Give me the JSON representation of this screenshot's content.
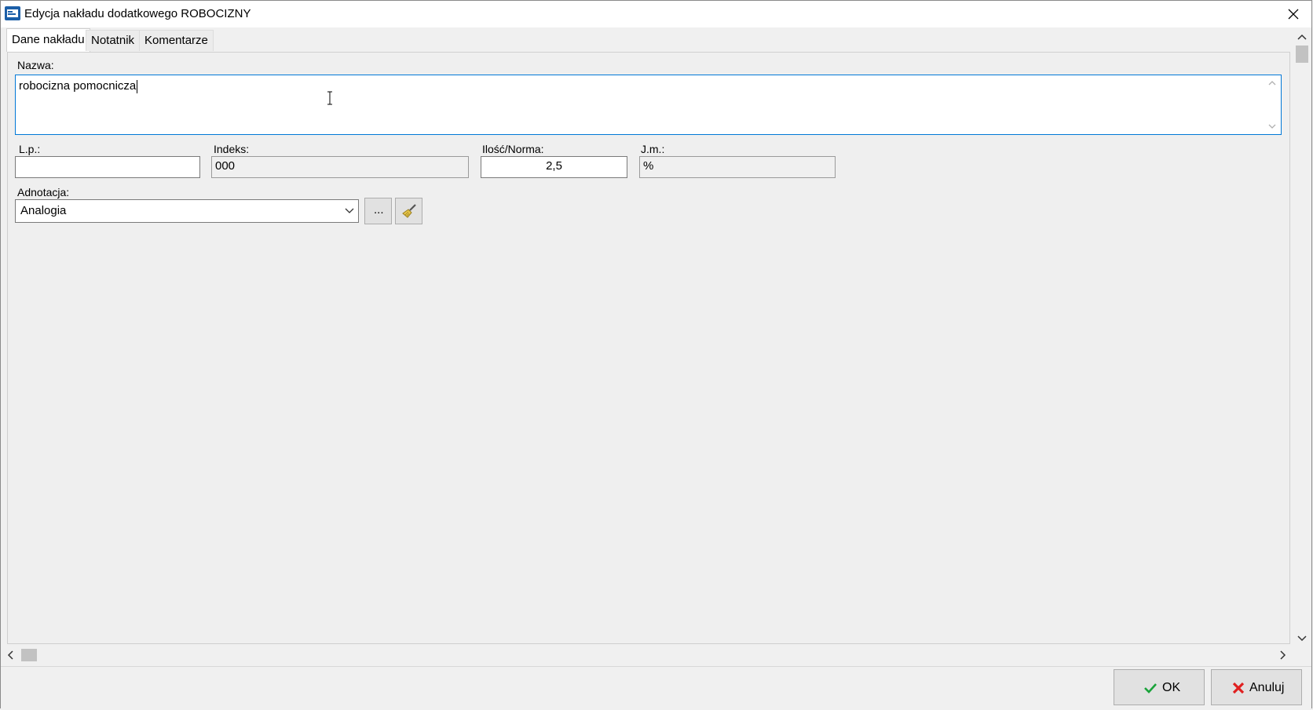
{
  "window": {
    "title": "Edycja nakładu dodatkowego ROBOCIZNY",
    "app_icon": "app-icon",
    "close_icon": "close-icon"
  },
  "tabs": [
    {
      "label": "Dane nakładu",
      "active": true
    },
    {
      "label": "Notatnik",
      "active": false
    },
    {
      "label": "Komentarze",
      "active": false
    }
  ],
  "form": {
    "nazwa_label": "Nazwa:",
    "nazwa_value": "robocizna pomocnicza",
    "lp_label": "L.p.:",
    "lp_value": "",
    "indeks_label": "Indeks:",
    "indeks_value": "000",
    "ilosc_label": "Ilość/Norma:",
    "ilosc_value": "2,5",
    "jm_label": "J.m.:",
    "jm_value": "%",
    "adnotacja_label": "Adnotacja:",
    "adnotacja_value": "Analogia",
    "browse_label": "...",
    "clear_icon": "broom-icon"
  },
  "footer": {
    "ok_label": "OK",
    "cancel_label": "Anuluj"
  },
  "colors": {
    "focus_border": "#0078d7",
    "ok_check": "#1aa33a",
    "cancel_x": "#e02020"
  }
}
